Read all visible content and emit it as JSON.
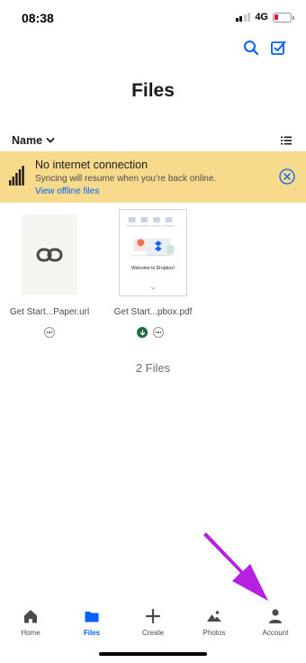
{
  "status_bar": {
    "time": "08:38",
    "network": "4G",
    "signal_bars_on": 2,
    "signal_bars_total": 4,
    "battery_color": "#e6102e"
  },
  "header": {
    "title": "Files",
    "actions": [
      {
        "icon": "search-icon"
      },
      {
        "icon": "select-checkbox-icon"
      }
    ]
  },
  "sort": {
    "label": "Name",
    "icon": "chevron-down-icon",
    "view_icon": "list-view-icon"
  },
  "banner": {
    "title": "No internet connection",
    "subtitle": "Syncing will resume when you’re back online.",
    "link": "View offline files",
    "background": "#f8da8d",
    "link_color": "#0061fe"
  },
  "files": [
    {
      "name": "Get Start...Paper.url",
      "icon": "link-icon",
      "available_offline": false
    },
    {
      "name": "Get Start...pbox.pdf",
      "preview_text": "Welcome to Dropbox!",
      "available_offline": true
    }
  ],
  "file_count": "2 Files",
  "tabs": [
    {
      "label": "Home",
      "icon": "home-icon",
      "active": false
    },
    {
      "label": "Files",
      "icon": "folder-icon",
      "active": true
    },
    {
      "label": "Create",
      "icon": "plus-icon",
      "active": false
    },
    {
      "label": "Photos",
      "icon": "photos-icon",
      "active": false
    },
    {
      "label": "Account",
      "icon": "person-icon",
      "active": false
    }
  ],
  "annotation_arrow_color": "#b620e0",
  "accent_color": "#0061fe"
}
